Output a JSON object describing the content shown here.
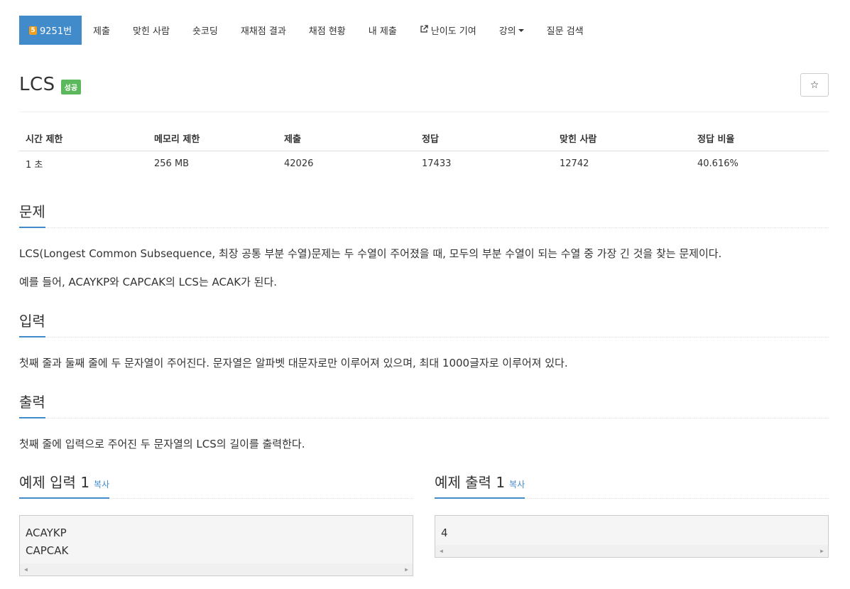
{
  "nav": {
    "problem": {
      "badge": "5",
      "label": "9251번"
    },
    "items": [
      {
        "label": "제출"
      },
      {
        "label": "맞힌 사람"
      },
      {
        "label": "숏코딩"
      },
      {
        "label": "재채점 결과"
      },
      {
        "label": "채점 현황"
      },
      {
        "label": "내 제출"
      },
      {
        "label": "난이도 기여"
      },
      {
        "label": "강의"
      },
      {
        "label": "질문 검색"
      }
    ]
  },
  "problem": {
    "title": "LCS",
    "status_label": "성공",
    "star": "☆"
  },
  "info": {
    "headers": [
      "시간 제한",
      "메모리 제한",
      "제출",
      "정답",
      "맞힌 사람",
      "정답 비율"
    ],
    "values": [
      "1 초",
      "256 MB",
      "42026",
      "17433",
      "12742",
      "40.616%"
    ]
  },
  "sections": {
    "problem": {
      "heading": "문제",
      "lines": [
        "LCS(Longest Common Subsequence, 최장 공통 부분 수열)문제는 두 수열이 주어졌을 때, 모두의 부분 수열이 되는 수열 중 가장 긴 것을 찾는 문제이다.",
        "예를 들어, ACAYKP와 CAPCAK의 LCS는 ACAK가 된다."
      ]
    },
    "input": {
      "heading": "입력",
      "text": "첫째 줄과 둘째 줄에 두 문자열이 주어진다. 문자열은 알파벳 대문자로만 이루어져 있으며, 최대 1000글자로 이루어져 있다."
    },
    "output": {
      "heading": "출력",
      "text": "첫째 줄에 입력으로 주어진 두 문자열의 LCS의 길이를 출력한다."
    }
  },
  "samples": {
    "input": {
      "heading": "예제 입력 1",
      "copy": "복사",
      "lines": [
        "ACAYKP",
        "CAPCAK"
      ]
    },
    "output": {
      "heading": "예제 출력 1",
      "copy": "복사",
      "lines": [
        "4"
      ]
    }
  }
}
